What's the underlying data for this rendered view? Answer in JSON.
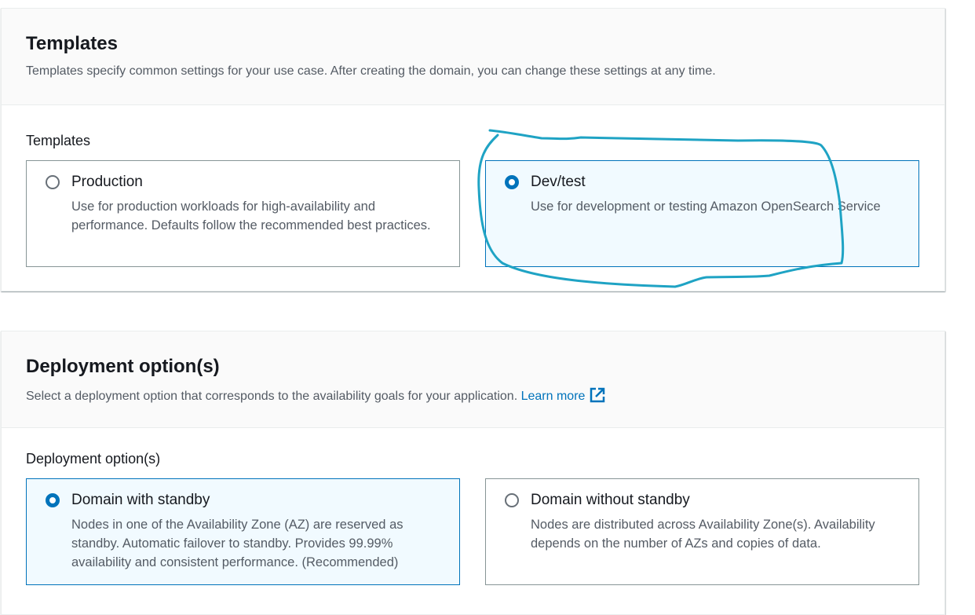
{
  "templates_panel": {
    "title": "Templates",
    "description": "Templates specify common settings for your use case. After creating the domain, you can change these settings at any time.",
    "field_label": "Templates",
    "options": [
      {
        "title": "Production",
        "description": "Use for production workloads for high-availability and performance. Defaults follow the recommended best practices.",
        "selected": false
      },
      {
        "title": "Dev/test",
        "description": "Use for development or testing Amazon OpenSearch Service",
        "selected": true
      }
    ]
  },
  "deployment_panel": {
    "title": "Deployment option(s)",
    "description": "Select a deployment option that corresponds to the availability goals for your application.",
    "learn_more": "Learn more",
    "learn_more_icon": "external-link-icon",
    "field_label": "Deployment option(s)",
    "options": [
      {
        "title": "Domain with standby",
        "description": "Nodes in one of the Availability Zone (AZ) are reserved as standby. Automatic failover to standby. Provides 99.99% availability and consistent performance. (Recommended)",
        "selected": true
      },
      {
        "title": "Domain without standby",
        "description": "Nodes are distributed across Availability Zone(s). Availability depends on the number of AZs and copies of data.",
        "selected": false
      }
    ]
  },
  "colors": {
    "accent": "#0073bb",
    "annotation_stroke": "#1fa3c4",
    "selected_tile_bg": "#f1faff"
  }
}
